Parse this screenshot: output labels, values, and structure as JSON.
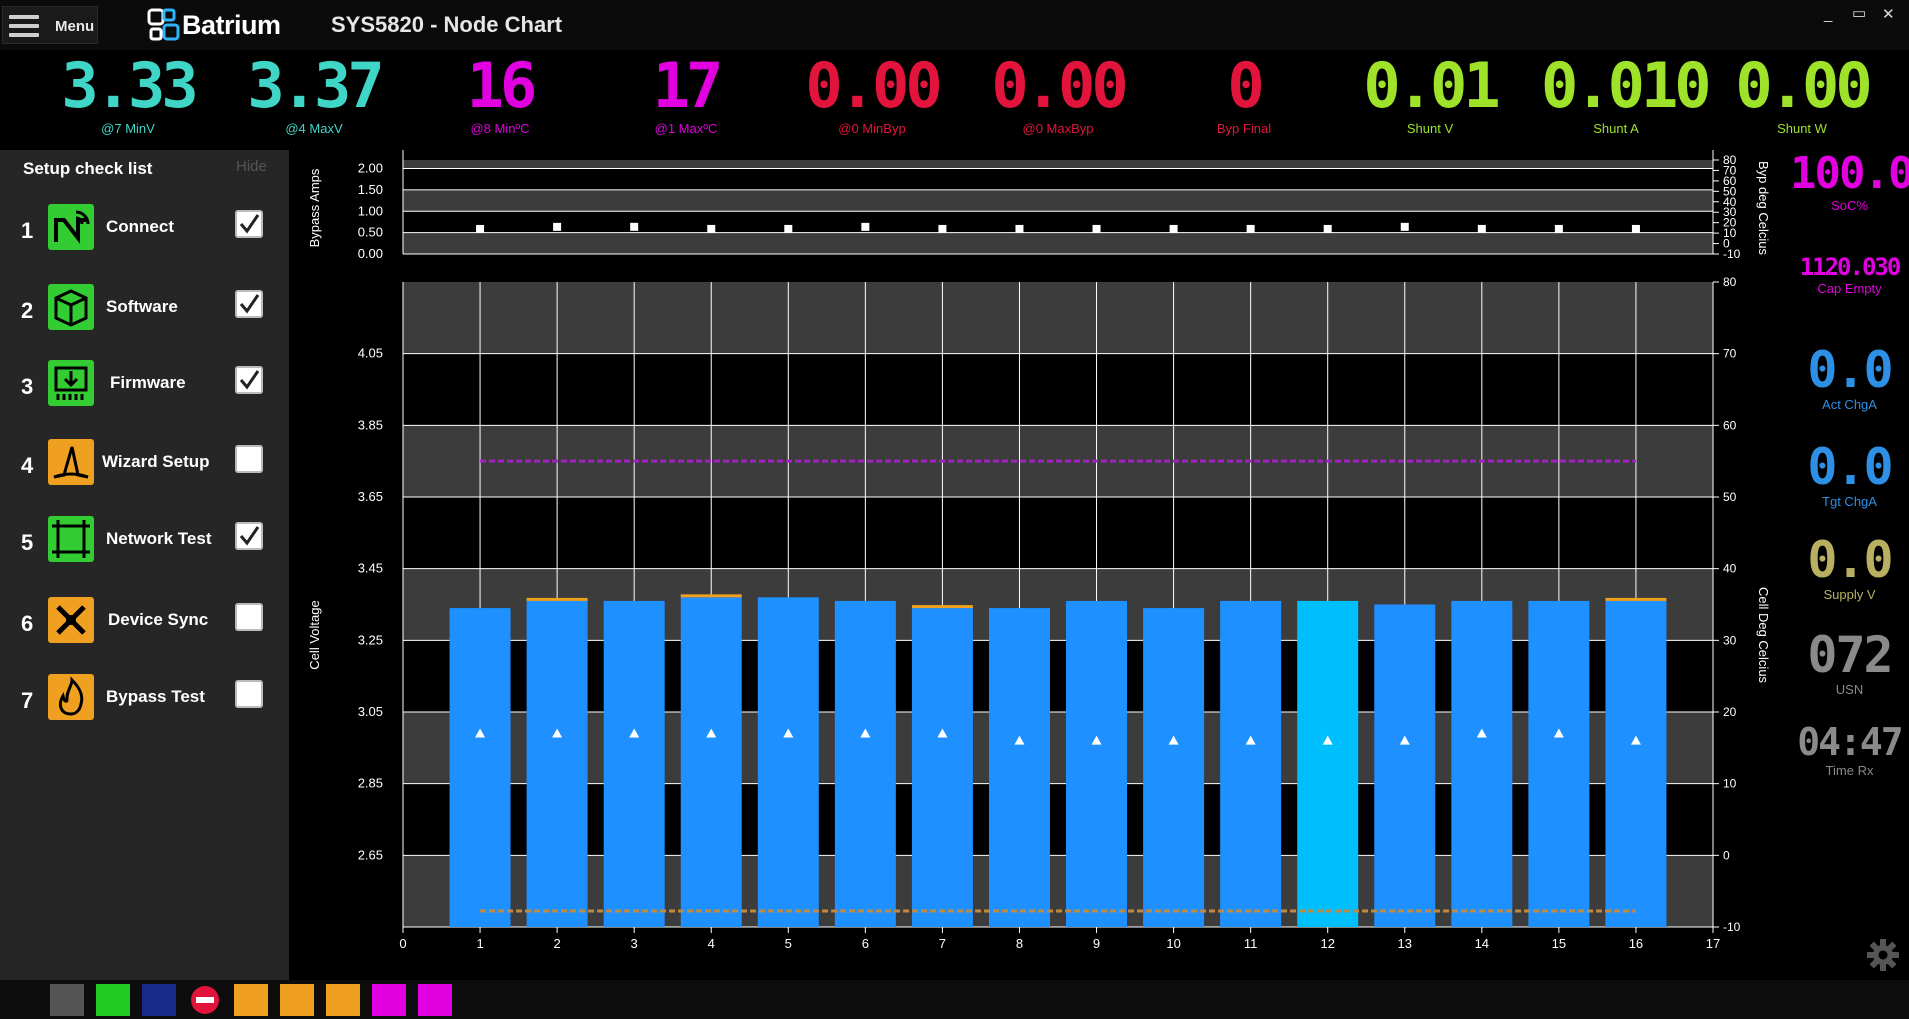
{
  "window": {
    "menu_label": "Menu",
    "brand": "Batrium",
    "title": "SYS5820 - Node Chart",
    "minimize": "_",
    "restore": "▭",
    "close": "✕"
  },
  "readouts": [
    {
      "value": "3.33",
      "caption": "@7 MinV",
      "color": "#3fd6c8"
    },
    {
      "value": "3.37",
      "caption": "@4 MaxV",
      "color": "#3fd6c8"
    },
    {
      "value": "16",
      "caption": "@8 MinºC",
      "color": "#e000e0"
    },
    {
      "value": "17",
      "caption": "@1 MaxºC",
      "color": "#e000e0"
    },
    {
      "value": "0.00",
      "caption": "@0 MinByp",
      "color": "#e2143c"
    },
    {
      "value": "0.00",
      "caption": "@0 MaxByp",
      "color": "#e2143c"
    },
    {
      "value": "0",
      "caption": "Byp Final",
      "color": "#e2143c"
    },
    {
      "value": "0.01",
      "caption": "Shunt V",
      "color": "#9ee22a"
    },
    {
      "value": "0.010",
      "caption": "Shunt A",
      "color": "#9ee22a"
    },
    {
      "value": "0.00",
      "caption": "Shunt W",
      "color": "#9ee22a"
    }
  ],
  "sidebar": {
    "title": "Setup check list",
    "hide_label": "Hide",
    "steps": [
      {
        "num": "1",
        "label": "Connect",
        "checked": true,
        "icon": "wireless-node-icon",
        "color": "#33cc33"
      },
      {
        "num": "2",
        "label": "Software",
        "checked": true,
        "icon": "software-box-icon",
        "color": "#33cc33"
      },
      {
        "num": "3",
        "label": "Firmware",
        "checked": true,
        "icon": "firmware-chip-icon",
        "color": "#33cc33"
      },
      {
        "num": "4",
        "label": "Wizard Setup",
        "checked": false,
        "icon": "wizard-hat-icon",
        "color": "#f0a020"
      },
      {
        "num": "5",
        "label": "Network Test",
        "checked": true,
        "icon": "network-test-icon",
        "color": "#33cc33"
      },
      {
        "num": "6",
        "label": "Device Sync",
        "checked": false,
        "icon": "device-sync-icon",
        "color": "#f0a020"
      },
      {
        "num": "7",
        "label": "Bypass Test",
        "checked": false,
        "icon": "bypass-flame-icon",
        "color": "#f0a020"
      }
    ]
  },
  "right_panel": [
    {
      "value": "100.0",
      "caption": "SoC%",
      "color": "#e000e0"
    },
    {
      "value": "1120.030",
      "caption": "Cap Empty",
      "color": "#e000e0"
    },
    {
      "value": "0.0",
      "caption": "Act ChgA",
      "color": "#2d8fe6"
    },
    {
      "value": "0.0",
      "caption": "Tgt ChgA",
      "color": "#2d8fe6"
    },
    {
      "value": "0.0",
      "caption": "Supply V",
      "color": "#b8b060"
    },
    {
      "value": "072",
      "caption": "USN",
      "color": "#8a8a8a"
    },
    {
      "value": "04:47",
      "caption": "Time Rx",
      "color": "#8a8a8a"
    }
  ],
  "chart_data": [
    {
      "type": "scatter",
      "ylabel": "Bypass Amps",
      "y2label": "Byp deg Celcius",
      "ylim": [
        0,
        2.2
      ],
      "y_ticks": [
        "0.00",
        "0.50",
        "1.00",
        "1.50",
        "2.00"
      ],
      "y2lim": [
        -10,
        80
      ],
      "y2_ticks": [
        "-10",
        "0",
        "10",
        "20",
        "30",
        "40",
        "50",
        "60",
        "70",
        "80"
      ],
      "x": [
        1,
        2,
        3,
        4,
        5,
        6,
        7,
        8,
        9,
        10,
        11,
        12,
        13,
        14,
        15,
        16
      ],
      "series": [
        {
          "values": [
            14,
            16,
            16,
            14,
            14,
            16,
            14,
            14,
            14,
            14,
            14,
            14,
            16,
            14,
            14,
            14
          ],
          "axis": "y2",
          "marker": "square",
          "color": "#ffffff"
        }
      ],
      "grid": true
    },
    {
      "type": "bar",
      "ylabel": "Cell Voltage",
      "y2label": "Cell Deg Celcius",
      "xlim": [
        0,
        17
      ],
      "x_ticks": [
        "0",
        "1",
        "2",
        "3",
        "4",
        "5",
        "6",
        "7",
        "8",
        "9",
        "10",
        "11",
        "12",
        "13",
        "14",
        "15",
        "16",
        "17"
      ],
      "ylim": [
        2.45,
        4.25
      ],
      "y_ticks": [
        "2.65",
        "2.85",
        "3.05",
        "3.25",
        "3.45",
        "3.65",
        "3.85",
        "4.05"
      ],
      "y2lim": [
        -10,
        80
      ],
      "y2_ticks": [
        "-10",
        "0",
        "10",
        "20",
        "30",
        "40",
        "50",
        "60",
        "70",
        "80"
      ],
      "categories": [
        1,
        2,
        3,
        4,
        5,
        6,
        7,
        8,
        9,
        10,
        11,
        12,
        13,
        14,
        15,
        16
      ],
      "series": [
        {
          "values": [
            3.34,
            3.36,
            3.36,
            3.37,
            3.37,
            3.36,
            3.34,
            3.34,
            3.36,
            3.34,
            3.36,
            3.36,
            3.35,
            3.36,
            3.36,
            3.36
          ],
          "color": "#1e90ff",
          "highlight_index": 11,
          "highlight_color": "#00bfff"
        },
        {
          "values": [
            17,
            17,
            17,
            17,
            17,
            17,
            17,
            16,
            16,
            16,
            16,
            16,
            16,
            17,
            17,
            16
          ],
          "axis": "y2",
          "marker": "triangle",
          "color": "#ffffff"
        }
      ],
      "bypass_marks": [
        false,
        true,
        false,
        true,
        false,
        false,
        true,
        false,
        false,
        false,
        false,
        false,
        false,
        false,
        false,
        true
      ],
      "high_limit_line": 3.75,
      "low_limit_line": 2.5,
      "grid": true
    }
  ],
  "bottom_icons": [
    {
      "icon": "wireless-node-icon",
      "color": "#555555"
    },
    {
      "icon": "runner-icon",
      "color": "#22cc22"
    },
    {
      "icon": "gear-network-icon",
      "color": "#1a2a8a"
    },
    {
      "icon": "stop-icon",
      "color": "#e2143c"
    },
    {
      "icon": "wizard-hat-icon",
      "color": "#f0a020"
    },
    {
      "icon": "device-sync-icon",
      "color": "#f0a020"
    },
    {
      "icon": "bypass-flame-icon",
      "color": "#f0a020"
    },
    {
      "icon": "lightning-icon",
      "color": "#e000e0"
    },
    {
      "icon": "splat-icon",
      "color": "#e000e0"
    }
  ]
}
